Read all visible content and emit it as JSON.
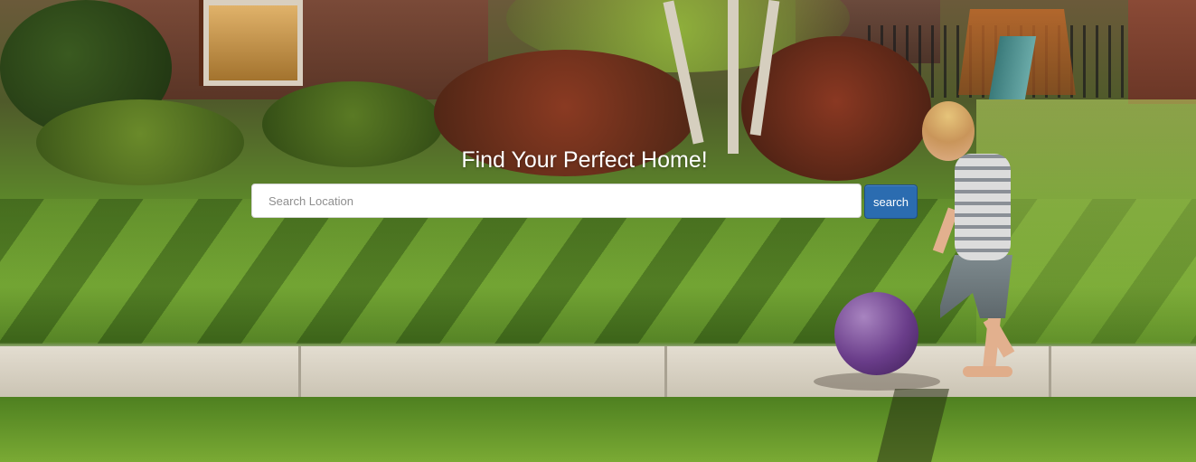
{
  "hero": {
    "headline": "Find Your Perfect Home!",
    "background_image": "sunlit front lawn with child kicking purple ball"
  },
  "search": {
    "placeholder": "Search Location",
    "value": "",
    "button_label": "search"
  },
  "colors": {
    "button_background": "#2b6cb0",
    "headline_text": "#ffffff"
  }
}
